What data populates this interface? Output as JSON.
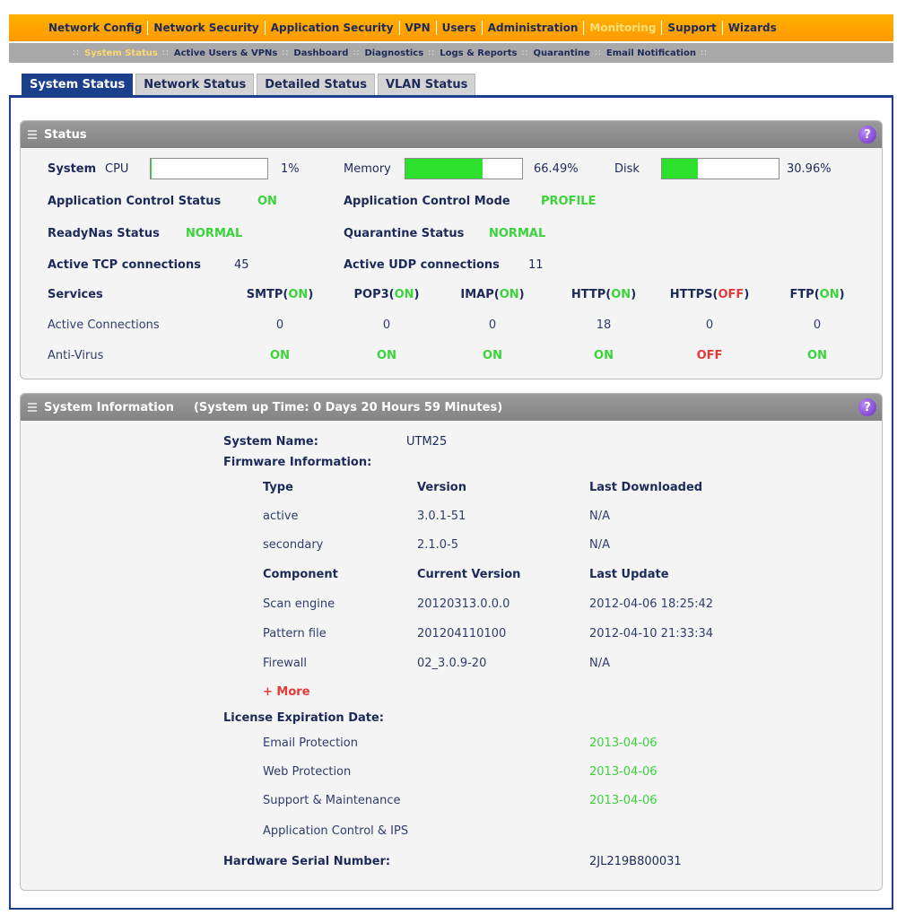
{
  "nav": {
    "items": [
      "Network Config",
      "Network Security",
      "Application Security",
      "VPN",
      "Users",
      "Administration",
      "Monitoring",
      "Support",
      "Wizards"
    ],
    "active_index": 6
  },
  "subnav": {
    "items": [
      "System Status",
      "Active Users & VPNs",
      "Dashboard",
      "Diagnostics",
      "Logs & Reports",
      "Quarantine",
      "Email Notification"
    ],
    "active_index": 0
  },
  "tabs": [
    "System Status",
    "Network Status",
    "Detailed Status",
    "VLAN Status"
  ],
  "status": {
    "title": "Status",
    "system_label": "System",
    "cpu_label": "CPU",
    "cpu_value": "1%",
    "cpu_fraction": 0.01,
    "memory_label": "Memory",
    "memory_value": "66.49%",
    "memory_fraction": 0.6649,
    "disk_label": "Disk",
    "disk_value": "30.96%",
    "disk_fraction": 0.3096,
    "app_control_status_label": "Application Control Status",
    "app_control_status_value": "ON",
    "app_control_mode_label": "Application Control Mode",
    "app_control_mode_value": "PROFILE",
    "readynas_label": "ReadyNas Status",
    "readynas_value": "NORMAL",
    "quarantine_label": "Quarantine Status",
    "quarantine_value": "NORMAL",
    "tcp_label": "Active TCP connections",
    "tcp_value": "45",
    "udp_label": "Active UDP connections",
    "udp_value": "11",
    "services_label": "Services",
    "active_connections_label": "Active Connections",
    "antivirus_label": "Anti-Virus",
    "services": [
      {
        "name": "SMTP",
        "state": "ON",
        "connections": "0",
        "antivirus": "ON"
      },
      {
        "name": "POP3",
        "state": "ON",
        "connections": "0",
        "antivirus": "ON"
      },
      {
        "name": "IMAP",
        "state": "ON",
        "connections": "0",
        "antivirus": "ON"
      },
      {
        "name": "HTTP",
        "state": "ON",
        "connections": "18",
        "antivirus": "ON"
      },
      {
        "name": "HTTPS",
        "state": "OFF",
        "connections": "0",
        "antivirus": "OFF"
      },
      {
        "name": "FTP",
        "state": "ON",
        "connections": "0",
        "antivirus": "ON"
      }
    ],
    "colors": {
      "on": "#3ad43a",
      "off": "#e23a3a",
      "bar_fill": "#2ee02e"
    }
  },
  "sysinfo": {
    "title": "System Information",
    "uptime": "(System up Time: 0 Days 20 Hours 59 Minutes)",
    "system_name_label": "System Name:",
    "system_name_value": "UTM25",
    "firmware_label": "Firmware Information:",
    "fw_headers": [
      "Type",
      "Version",
      "Last Downloaded"
    ],
    "fw_rows": [
      [
        "active",
        "3.0.1-51",
        "N/A"
      ],
      [
        "secondary",
        "2.1.0-5",
        "N/A"
      ]
    ],
    "comp_headers": [
      "Component",
      "Current Version",
      "Last Update"
    ],
    "comp_rows": [
      [
        "Scan engine",
        "20120313.0.0.0",
        "2012-04-06 18:25:42"
      ],
      [
        "Pattern file",
        "201204110100",
        "2012-04-10 21:33:34"
      ],
      [
        "Firewall",
        "02_3.0.9-20",
        "N/A"
      ]
    ],
    "more_label": "+ More",
    "license_label": "License Expiration Date:",
    "licenses": [
      [
        "Email Protection",
        "2013-04-06"
      ],
      [
        "Web Protection",
        "2013-04-06"
      ],
      [
        "Support & Maintenance",
        "2013-04-06"
      ],
      [
        "Application Control & IPS",
        ""
      ]
    ],
    "serial_label": "Hardware Serial Number:",
    "serial_value": "2JL219B800031"
  }
}
